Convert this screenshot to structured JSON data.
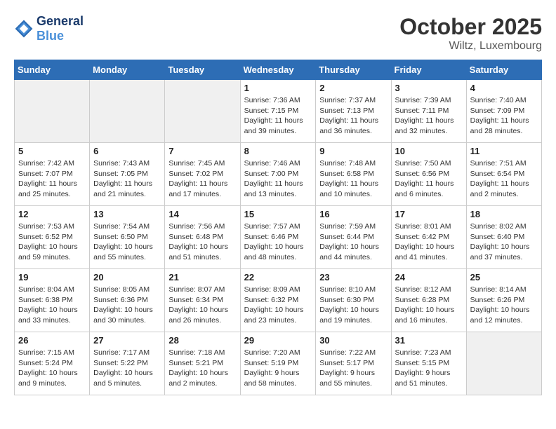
{
  "header": {
    "logo_line1": "General",
    "logo_line2": "Blue",
    "month_title": "October 2025",
    "location": "Wiltz, Luxembourg"
  },
  "weekdays": [
    "Sunday",
    "Monday",
    "Tuesday",
    "Wednesday",
    "Thursday",
    "Friday",
    "Saturday"
  ],
  "weeks": [
    [
      {
        "day": "",
        "info": ""
      },
      {
        "day": "",
        "info": ""
      },
      {
        "day": "",
        "info": ""
      },
      {
        "day": "1",
        "info": "Sunrise: 7:36 AM\nSunset: 7:15 PM\nDaylight: 11 hours and 39 minutes."
      },
      {
        "day": "2",
        "info": "Sunrise: 7:37 AM\nSunset: 7:13 PM\nDaylight: 11 hours and 36 minutes."
      },
      {
        "day": "3",
        "info": "Sunrise: 7:39 AM\nSunset: 7:11 PM\nDaylight: 11 hours and 32 minutes."
      },
      {
        "day": "4",
        "info": "Sunrise: 7:40 AM\nSunset: 7:09 PM\nDaylight: 11 hours and 28 minutes."
      }
    ],
    [
      {
        "day": "5",
        "info": "Sunrise: 7:42 AM\nSunset: 7:07 PM\nDaylight: 11 hours and 25 minutes."
      },
      {
        "day": "6",
        "info": "Sunrise: 7:43 AM\nSunset: 7:05 PM\nDaylight: 11 hours and 21 minutes."
      },
      {
        "day": "7",
        "info": "Sunrise: 7:45 AM\nSunset: 7:02 PM\nDaylight: 11 hours and 17 minutes."
      },
      {
        "day": "8",
        "info": "Sunrise: 7:46 AM\nSunset: 7:00 PM\nDaylight: 11 hours and 13 minutes."
      },
      {
        "day": "9",
        "info": "Sunrise: 7:48 AM\nSunset: 6:58 PM\nDaylight: 11 hours and 10 minutes."
      },
      {
        "day": "10",
        "info": "Sunrise: 7:50 AM\nSunset: 6:56 PM\nDaylight: 11 hours and 6 minutes."
      },
      {
        "day": "11",
        "info": "Sunrise: 7:51 AM\nSunset: 6:54 PM\nDaylight: 11 hours and 2 minutes."
      }
    ],
    [
      {
        "day": "12",
        "info": "Sunrise: 7:53 AM\nSunset: 6:52 PM\nDaylight: 10 hours and 59 minutes."
      },
      {
        "day": "13",
        "info": "Sunrise: 7:54 AM\nSunset: 6:50 PM\nDaylight: 10 hours and 55 minutes."
      },
      {
        "day": "14",
        "info": "Sunrise: 7:56 AM\nSunset: 6:48 PM\nDaylight: 10 hours and 51 minutes."
      },
      {
        "day": "15",
        "info": "Sunrise: 7:57 AM\nSunset: 6:46 PM\nDaylight: 10 hours and 48 minutes."
      },
      {
        "day": "16",
        "info": "Sunrise: 7:59 AM\nSunset: 6:44 PM\nDaylight: 10 hours and 44 minutes."
      },
      {
        "day": "17",
        "info": "Sunrise: 8:01 AM\nSunset: 6:42 PM\nDaylight: 10 hours and 41 minutes."
      },
      {
        "day": "18",
        "info": "Sunrise: 8:02 AM\nSunset: 6:40 PM\nDaylight: 10 hours and 37 minutes."
      }
    ],
    [
      {
        "day": "19",
        "info": "Sunrise: 8:04 AM\nSunset: 6:38 PM\nDaylight: 10 hours and 33 minutes."
      },
      {
        "day": "20",
        "info": "Sunrise: 8:05 AM\nSunset: 6:36 PM\nDaylight: 10 hours and 30 minutes."
      },
      {
        "day": "21",
        "info": "Sunrise: 8:07 AM\nSunset: 6:34 PM\nDaylight: 10 hours and 26 minutes."
      },
      {
        "day": "22",
        "info": "Sunrise: 8:09 AM\nSunset: 6:32 PM\nDaylight: 10 hours and 23 minutes."
      },
      {
        "day": "23",
        "info": "Sunrise: 8:10 AM\nSunset: 6:30 PM\nDaylight: 10 hours and 19 minutes."
      },
      {
        "day": "24",
        "info": "Sunrise: 8:12 AM\nSunset: 6:28 PM\nDaylight: 10 hours and 16 minutes."
      },
      {
        "day": "25",
        "info": "Sunrise: 8:14 AM\nSunset: 6:26 PM\nDaylight: 10 hours and 12 minutes."
      }
    ],
    [
      {
        "day": "26",
        "info": "Sunrise: 7:15 AM\nSunset: 5:24 PM\nDaylight: 10 hours and 9 minutes."
      },
      {
        "day": "27",
        "info": "Sunrise: 7:17 AM\nSunset: 5:22 PM\nDaylight: 10 hours and 5 minutes."
      },
      {
        "day": "28",
        "info": "Sunrise: 7:18 AM\nSunset: 5:21 PM\nDaylight: 10 hours and 2 minutes."
      },
      {
        "day": "29",
        "info": "Sunrise: 7:20 AM\nSunset: 5:19 PM\nDaylight: 9 hours and 58 minutes."
      },
      {
        "day": "30",
        "info": "Sunrise: 7:22 AM\nSunset: 5:17 PM\nDaylight: 9 hours and 55 minutes."
      },
      {
        "day": "31",
        "info": "Sunrise: 7:23 AM\nSunset: 5:15 PM\nDaylight: 9 hours and 51 minutes."
      },
      {
        "day": "",
        "info": ""
      }
    ]
  ]
}
